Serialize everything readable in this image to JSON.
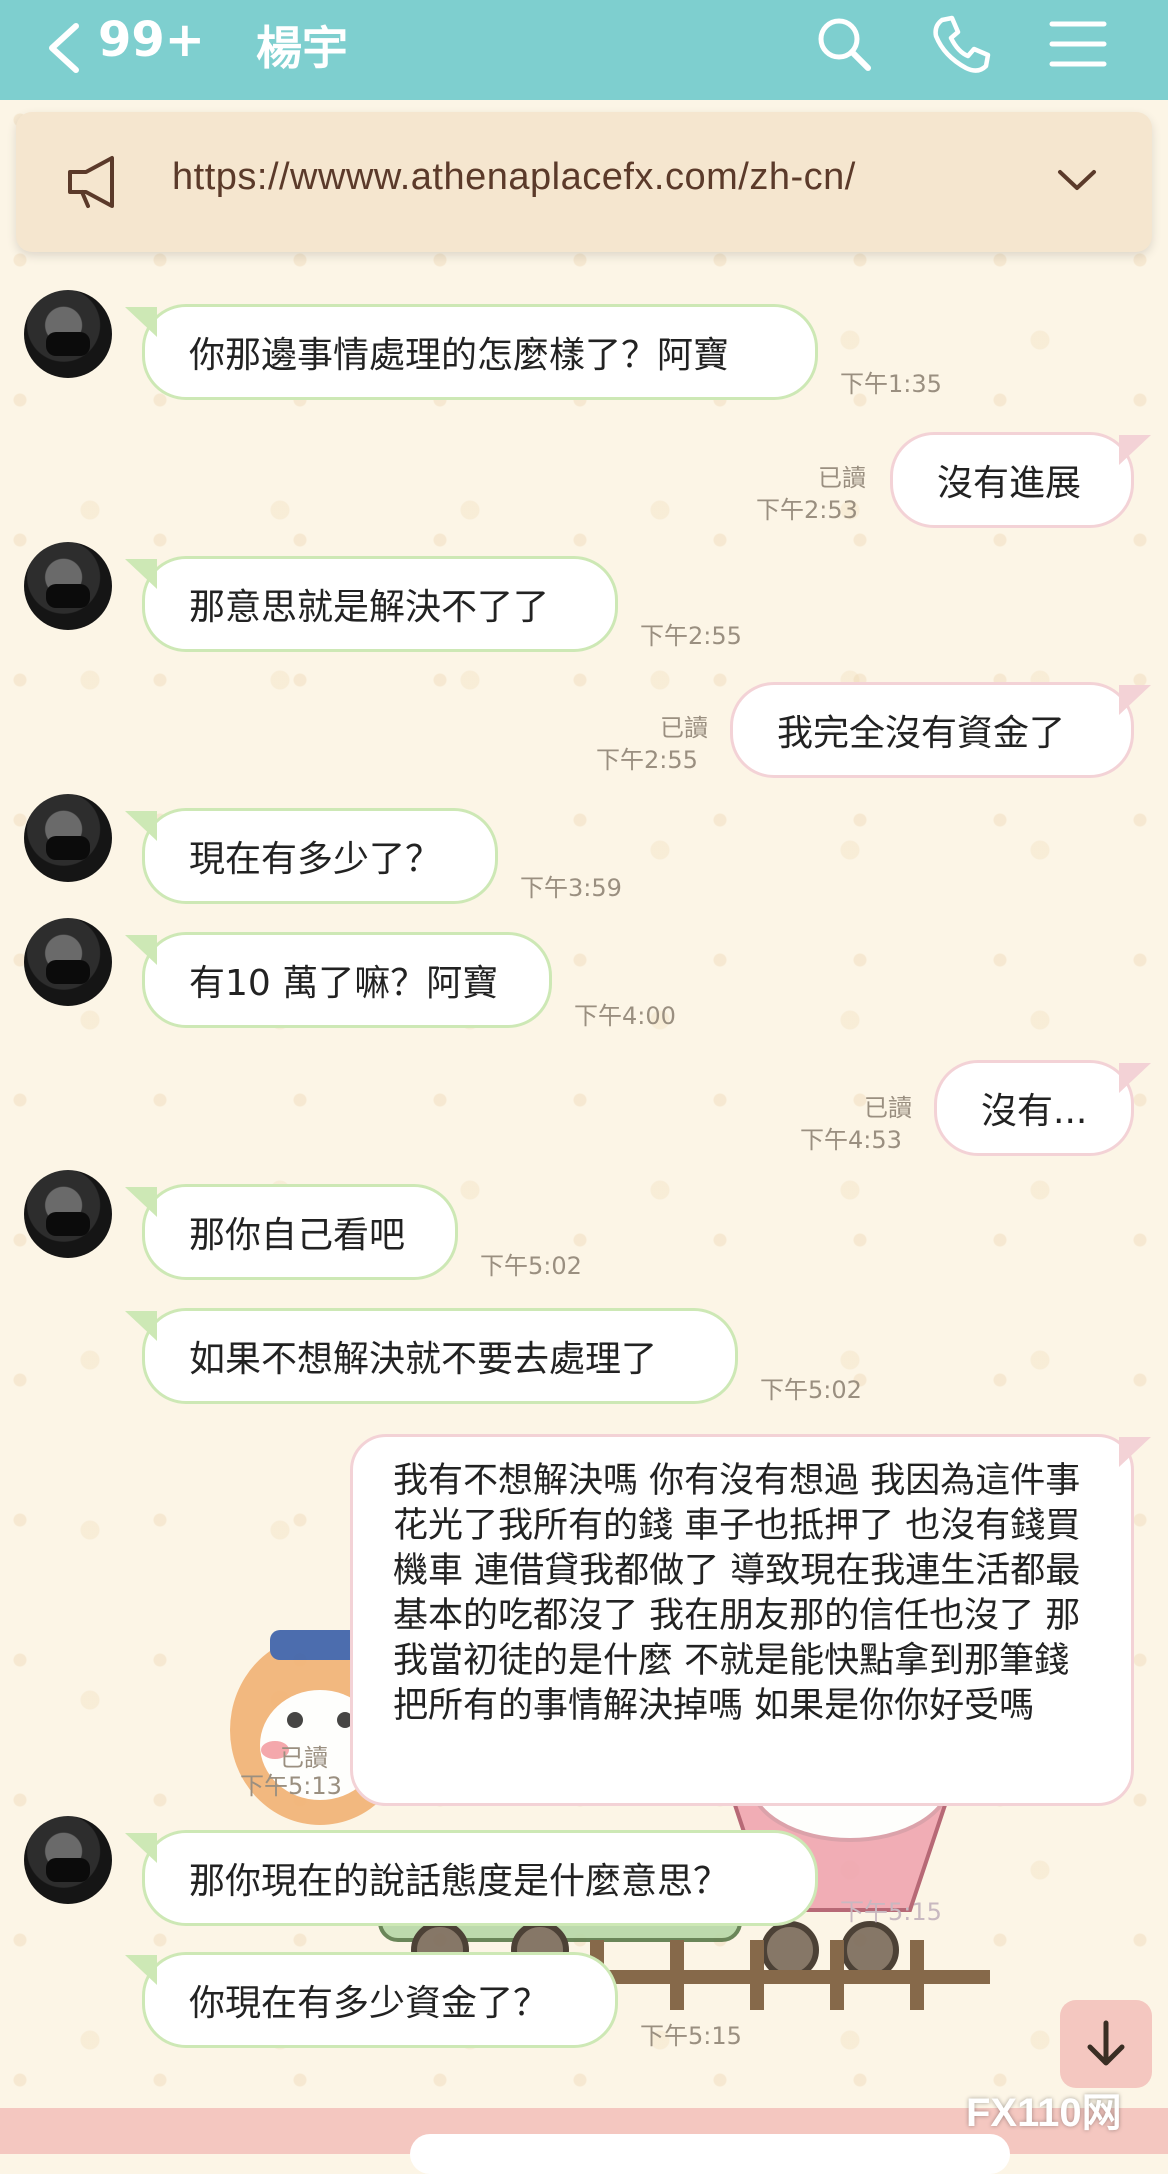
{
  "header": {
    "unread_count": "99+",
    "contact_name": "楊宇",
    "bg_color": "#7ecfcf"
  },
  "announcement": {
    "url": "https://wwww.athenaplacefx.com/zh-cn/"
  },
  "messages": [
    {
      "dir": "in",
      "text": "你那邊事情處理的怎麼樣了？阿寶",
      "time": "下午1:35"
    },
    {
      "dir": "out",
      "text": "沒有進展",
      "time": "下午2:53",
      "read": "已讀"
    },
    {
      "dir": "in",
      "text": "那意思就是解決不了了",
      "time": "下午2:55"
    },
    {
      "dir": "out",
      "text": "我完全沒有資金了",
      "time": "下午2:55",
      "read": "已讀"
    },
    {
      "dir": "in",
      "text": "現在有多少了？",
      "time": "下午3:59"
    },
    {
      "dir": "in",
      "text": "有10 萬了嘛？阿寶",
      "time": "下午4:00"
    },
    {
      "dir": "out",
      "text": "沒有...",
      "time": "下午4:53",
      "read": "已讀"
    },
    {
      "dir": "in",
      "text": "那你自己看吧",
      "time": "下午5:02"
    },
    {
      "dir": "in",
      "text": "如果不想解決就不要去處理了",
      "time": "下午5:02"
    },
    {
      "dir": "out",
      "text": "我有不想解決嗎 你有沒有想過 我因為這件事花光了我所有的錢 車子也抵押了 也沒有錢買機車 連借貸我都做了 導致現在我連生活都最基本的吃都沒了 我在朋友那的信任也沒了 那我當初徒的是什麼 不就是能快點拿到那筆錢 把所有的事情解決掉嗎 如果是你你好受嗎"
    },
    {
      "dir": "out",
      "text": "",
      "time": "下午5:13",
      "read": "已讀",
      "sticker": true
    },
    {
      "dir": "in",
      "text": "那你現在的說話態度是什麼意思？",
      "time": "下午5:15"
    },
    {
      "dir": "in",
      "text": "你現在有多少資金了？",
      "time": "下午5:15"
    }
  ],
  "watermark": "FX110网",
  "icons": [
    "back-icon",
    "search-icon",
    "phone-icon",
    "menu-icon",
    "megaphone-icon",
    "chevron-down-icon",
    "arrow-down-icon"
  ]
}
